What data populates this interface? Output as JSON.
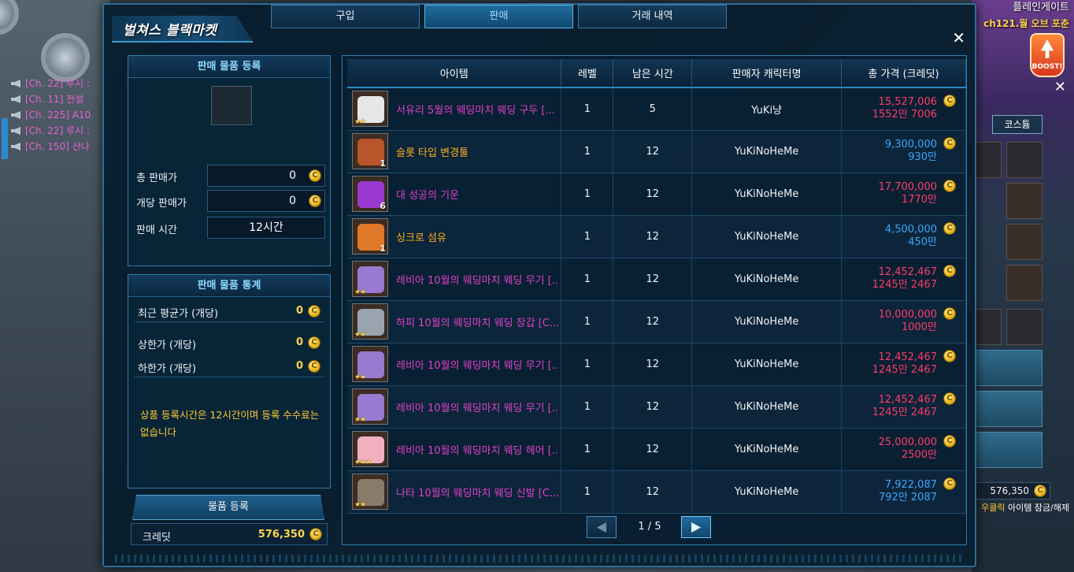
{
  "game": {
    "title": "플레인게이트",
    "subtitle": "ch121.월 오브 포춘",
    "boost": "BOOST!",
    "costume_tab": "코스튬",
    "credit": "576,350",
    "hint_highlight": "우클릭",
    "hint_text": "아이템 잠금/해제"
  },
  "chat": [
    {
      "text": "[Ch. 22] 루시 :",
      "color": "#e860d0"
    },
    {
      "text": "[Ch. 11] 전설",
      "color": "#e860d0"
    },
    {
      "text": "[Ch. 225] A10",
      "color": "#e860d0"
    },
    {
      "text": "[Ch. 22] 루시 :",
      "color": "#e860d0"
    },
    {
      "text": "[Ch. 150] 산나",
      "color": "#e860d0"
    }
  ],
  "window": {
    "title": "벌쳐스 블랙마켓",
    "close": "✕",
    "tabs": [
      {
        "label": "구입",
        "active": false
      },
      {
        "label": "판매",
        "active": true
      },
      {
        "label": "거래 내역",
        "active": false
      }
    ]
  },
  "register": {
    "header": "판매 물품 등록",
    "total_label": "총 판매가",
    "total_value": "0",
    "unit_label": "개당 판매가",
    "unit_value": "0",
    "time_label": "판매 시간",
    "time_value": "12시간"
  },
  "stats": {
    "header": "판매 물품 통계",
    "avg_label": "최근 평균가 (개당)",
    "avg_value": "0",
    "high_label": "상한가 (개당)",
    "high_value": "0",
    "low_label": "하한가 (개당)",
    "low_value": "0"
  },
  "notice": "상품 등록시간은 12시간이며 등록 수수료는 없습니다",
  "register_button": "물품 등록",
  "credit": {
    "label": "크레딧",
    "value": "576,350"
  },
  "coin_glyph": "C",
  "table": {
    "columns": [
      "아이템",
      "레벨",
      "남은 시간",
      "판매자 캐릭터명",
      "총 가격 (크레딧)"
    ],
    "rows": [
      {
        "name": "서유리 5월의 웨딩마치 웨딩 구두 [...",
        "name_color": "#e040c8",
        "level": "1",
        "time": "5",
        "seller": "YuKi냥",
        "price": "15,527,006",
        "price_sub": "1552만 7006",
        "price_color": "#ff3a6a",
        "icon": "shoes-icon",
        "icon_color": "#e6e6e6",
        "qty": "",
        "stars": "★★"
      },
      {
        "name": "슬롯 타입 변경툴",
        "name_color": "#ffb020",
        "level": "1",
        "time": "12",
        "seller": "YuKiNoHeMe",
        "price": "9,300,000",
        "price_sub": "930만",
        "price_color": "#3aa8ff",
        "icon": "tool-icon",
        "icon_color": "#b8552a",
        "qty": "1",
        "stars": ""
      },
      {
        "name": "대 성공의 기운",
        "name_color": "#e040c8",
        "level": "1",
        "time": "12",
        "seller": "YuKiNoHeMe",
        "price": "17,700,000",
        "price_sub": "1770만",
        "price_color": "#ff3a6a",
        "icon": "potion-icon",
        "icon_color": "#9a3ad0",
        "qty": "6",
        "stars": ""
      },
      {
        "name": "싱크로 섬유",
        "name_color": "#ffb020",
        "level": "1",
        "time": "12",
        "seller": "YuKiNoHeMe",
        "price": "4,500,000",
        "price_sub": "450만",
        "price_color": "#3aa8ff",
        "icon": "fiber-icon",
        "icon_color": "#e07a2a",
        "qty": "1",
        "stars": ""
      },
      {
        "name": "레비아 10월의 웨딩마치 웨딩 무기 [...",
        "name_color": "#e040c8",
        "level": "1",
        "time": "12",
        "seller": "YuKiNoHeMe",
        "price": "12,452,467",
        "price_sub": "1245만 2467",
        "price_color": "#ff3a6a",
        "icon": "weapon-icon",
        "icon_color": "#9a7ad0",
        "qty": "",
        "stars": "★★"
      },
      {
        "name": "하피 10월의 웨딩마치 웨딩 장갑 [C...",
        "name_color": "#e040c8",
        "level": "1",
        "time": "12",
        "seller": "YuKiNoHeMe",
        "price": "10,000,000",
        "price_sub": "1000만",
        "price_color": "#ff3a6a",
        "icon": "glove-icon",
        "icon_color": "#9aa4ae",
        "qty": "",
        "stars": "★★"
      },
      {
        "name": "레비아 10월의 웨딩마치 웨딩 무기 [...",
        "name_color": "#e040c8",
        "level": "1",
        "time": "12",
        "seller": "YuKiNoHeMe",
        "price": "12,452,467",
        "price_sub": "1245만 2467",
        "price_color": "#ff3a6a",
        "icon": "weapon-icon",
        "icon_color": "#9a7ad0",
        "qty": "",
        "stars": "★★"
      },
      {
        "name": "레비아 10월의 웨딩마치 웨딩 무기 [...",
        "name_color": "#e040c8",
        "level": "1",
        "time": "12",
        "seller": "YuKiNoHeMe",
        "price": "12,452,467",
        "price_sub": "1245만 2467",
        "price_color": "#ff3a6a",
        "icon": "weapon-icon",
        "icon_color": "#9a7ad0",
        "qty": "",
        "stars": "★★"
      },
      {
        "name": "레비아 10월의 웨딩마치 웨딩 헤어 [...",
        "name_color": "#e040c8",
        "level": "1",
        "time": "12",
        "seller": "YuKiNoHeMe",
        "price": "25,000,000",
        "price_sub": "2500만",
        "price_color": "#ff3a6a",
        "icon": "hair-icon",
        "icon_color": "#f0b0c0",
        "qty": "",
        "stars": "★★★"
      },
      {
        "name": "나타 10월의 웨딩마치 웨딩 신발 [C...",
        "name_color": "#e040c8",
        "level": "1",
        "time": "12",
        "seller": "YuKiNoHeMe",
        "price": "7,922,087",
        "price_sub": "792만 2087",
        "price_color": "#3aa8ff",
        "icon": "boots-icon",
        "icon_color": "#8a7a6a",
        "qty": "",
        "stars": "★★"
      }
    ]
  },
  "pager": {
    "text": "1 / 5"
  }
}
